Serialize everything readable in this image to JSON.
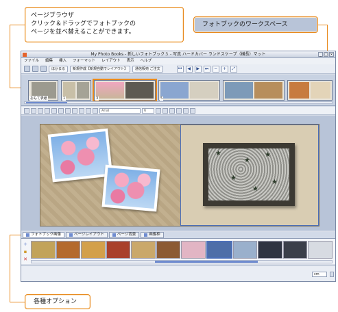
{
  "callouts": {
    "page_browser_title": "ページブラウザ",
    "page_browser_desc1": "クリック＆ドラッグでフォトブックの",
    "page_browser_desc2": "ページを並べ替えることができます。",
    "workspace": "フォトブックのワークスペース",
    "options": "各種オプション"
  },
  "window": {
    "title": "My Photo Books - 新しいフォトブック３ - 写真 ハードカバー ランドスケープ（横長）マット"
  },
  "menu": [
    "ファイル",
    "編集",
    "挿入",
    "フォーマット",
    "レイアウト",
    "表示",
    "ヘルプ"
  ],
  "toolbar": {
    "add_label": "ほかまる",
    "auto_label": "新規作成【新規自動でレイアウト】",
    "order_label": "通信販売 ご注文"
  },
  "page_browser": {
    "cover_label": "おもて表紙",
    "page_numbers": [
      "1",
      "3",
      "5"
    ]
  },
  "format_bar": {
    "font_value": "Arial",
    "size_value": "6"
  },
  "option_tabs": [
    "フォトブック画像",
    "ページレイアウト",
    "ページ背景",
    "画像枠"
  ],
  "status": {
    "unit": "cm"
  },
  "colors": {
    "callout_border": "#e8891c",
    "selection": "#4c6fb8"
  }
}
